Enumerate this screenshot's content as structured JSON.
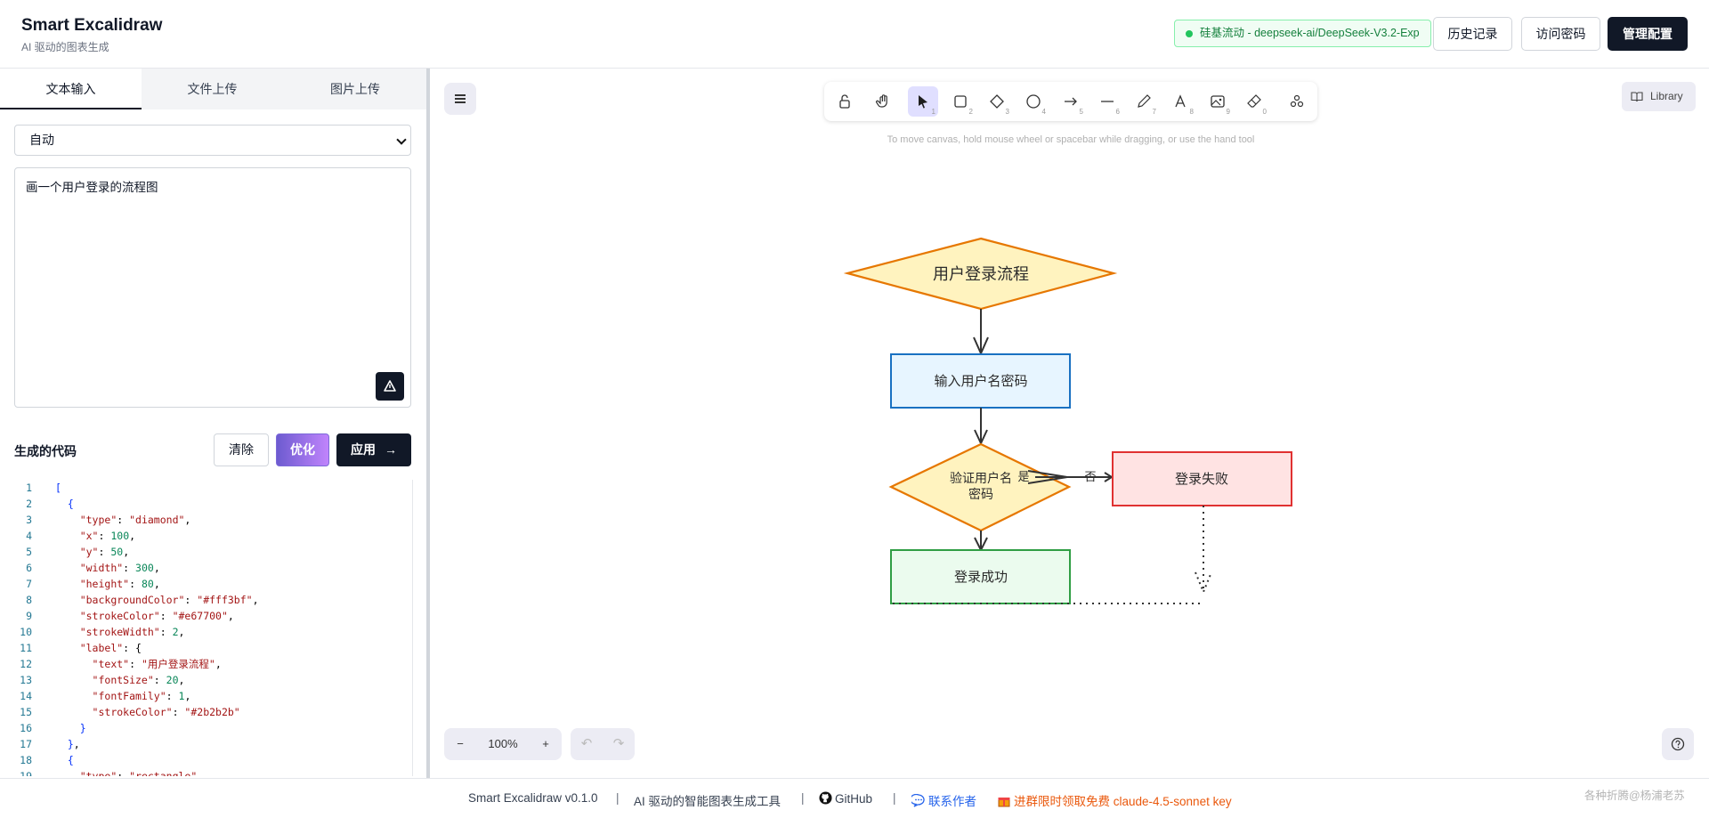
{
  "header": {
    "title": "Smart Excalidraw",
    "subtitle": "AI 驱动的图表生成",
    "model_badge": "硅基流动 - deepseek-ai/DeepSeek-V3.2-Exp",
    "history_label": "历史记录",
    "password_label": "访问密码",
    "admin_label": "管理配置"
  },
  "left_panel": {
    "tabs": [
      {
        "label": "文本输入",
        "active": true
      },
      {
        "label": "文件上传",
        "active": false
      },
      {
        "label": "图片上传",
        "active": false
      }
    ],
    "chart_type_select": "自动",
    "prompt_text": "画一个用户登录的流程图",
    "code_section_title": "生成的代码",
    "clear_label": "清除",
    "optimize_label": "优化",
    "apply_label": "应用",
    "code_lines": [
      "[",
      "  {",
      "    \"type\": \"diamond\",",
      "    \"x\": 100,",
      "    \"y\": 50,",
      "    \"width\": 300,",
      "    \"height\": 80,",
      "    \"backgroundColor\": \"#fff3bf\",",
      "    \"strokeColor\": \"#e67700\",",
      "    \"strokeWidth\": 2,",
      "    \"label\": {",
      "      \"text\": \"用户登录流程\",",
      "      \"fontSize\": 20,",
      "      \"fontFamily\": 1,",
      "      \"strokeColor\": \"#2b2b2b\"",
      "    }",
      "  },",
      "  {",
      "    \"type\": \"rectangle\","
    ]
  },
  "canvas": {
    "library_label": "Library",
    "hint": "To move canvas, hold mouse wheel or spacebar while dragging, or use the hand tool",
    "zoom_level": "100%",
    "tools": [
      {
        "icon": "lock-icon",
        "key": ""
      },
      {
        "icon": "hand-icon",
        "key": ""
      },
      {
        "icon": "pointer-icon",
        "key": "1"
      },
      {
        "icon": "rectangle-icon",
        "key": "2"
      },
      {
        "icon": "diamond-icon",
        "key": "3"
      },
      {
        "icon": "ellipse-icon",
        "key": "4"
      },
      {
        "icon": "arrow-icon",
        "key": "5"
      },
      {
        "icon": "line-icon",
        "key": "6"
      },
      {
        "icon": "pencil-icon",
        "key": "7"
      },
      {
        "icon": "text-icon",
        "key": "8"
      },
      {
        "icon": "image-icon",
        "key": "9"
      },
      {
        "icon": "eraser-icon",
        "key": "0"
      },
      {
        "icon": "shapes-icon",
        "key": ""
      }
    ],
    "diagram": {
      "start": "用户登录流程",
      "input": "输入用户名密码",
      "verify_line1": "验证用户名",
      "verify_line2": "密码",
      "yes_label": "是",
      "no_label": "否",
      "fail": "登录失败",
      "success": "登录成功"
    }
  },
  "footer": {
    "version": "Smart Excalidraw v0.1.0",
    "tagline": "AI 驱动的智能图表生成工具",
    "github": "GitHub",
    "contact": "联系作者",
    "promo": "进群限时领取免费 claude-4.5-sonnet key",
    "watermark": "各种折腾@杨浦老苏"
  },
  "colors": {
    "diamond_fill": "#fff3bf",
    "diamond_stroke": "#e67700",
    "rect_fill": "#e7f5ff",
    "rect_stroke": "#1971c2",
    "fail_fill": "#ffe3e3",
    "fail_stroke": "#e03131",
    "success_fill": "#ebfbee",
    "success_stroke": "#2f9e44"
  }
}
